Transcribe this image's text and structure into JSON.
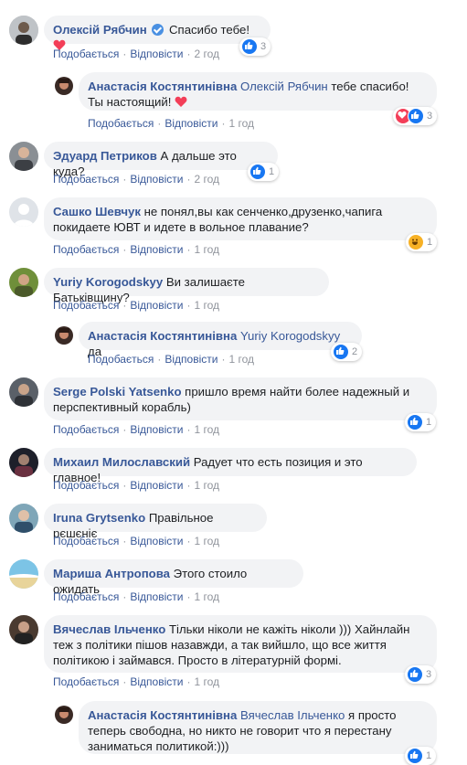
{
  "labels": {
    "like": "Подобається",
    "reply": "Відповісти",
    "sep": "·"
  },
  "comments": [
    {
      "name": "Олексій Рябчин",
      "verified": true,
      "text": "Спасибо тебе!",
      "time": "2 год",
      "reactions": "3"
    },
    {
      "name": "Анастасія Костянтинівна",
      "mention": "Олексій Рябчин",
      "text": "тебе спасибо! Ты настоящий!",
      "time": "1 год",
      "reactions": "3"
    },
    {
      "name": "Эдуард Петриков",
      "text": "А дальше это куда?",
      "time": "2 год",
      "reactions": "1"
    },
    {
      "name": "Сашко Шевчук",
      "text": "не понял,вы как сенченко,друзенко,чапига покидаете ЮВТ и идете в вольное плавание?",
      "time": "1 год",
      "reactions": "1"
    },
    {
      "name": "Yuriy Korogodskyy",
      "text": "Ви залишаєте Батьківщину?",
      "time": "1 год"
    },
    {
      "name": "Анастасія Костянтинівна",
      "mention": "Yuriy Korogodskyy",
      "text": "да",
      "time": "1 год",
      "reactions": "2"
    },
    {
      "name": "Serge Polski Yatsenko",
      "text": "пришло время найти более надежный и перспективный корабль)",
      "time": "1 год",
      "reactions": "1"
    },
    {
      "name": "Михаил Милославский",
      "text": "Радует что есть позиция и это главное!",
      "time": "1 год"
    },
    {
      "name": "Iruna Grytsenko",
      "text": "Правільное рєшєніє",
      "time": "1 год"
    },
    {
      "name": "Мариша Антропова",
      "text": "Этого стоило ожидать",
      "time": "1 год"
    },
    {
      "name": "Вячеслав Ільченко",
      "text": "Тільки ніколи не кажіть ніколи ))) Хайнлайн теж з політики пішов назавжди, а так вийшло, що все життя політикою і займався. Просто в літературній формі.",
      "time": "1 год",
      "reactions": "3"
    },
    {
      "name": "Анастасія Костянтинівна",
      "mention": "Вячеслав Ільченко",
      "text": "я просто теперь свободна, но никто не говорит что я перестану заниматься политикой:)))",
      "time": "1 год",
      "reactions": "1"
    }
  ],
  "colors": {
    "link": "#385898",
    "bubble": "#f2f3f5",
    "muted": "#90949c",
    "like": "#1877f2",
    "love": "#f33e58",
    "haha": "#f7b125"
  }
}
